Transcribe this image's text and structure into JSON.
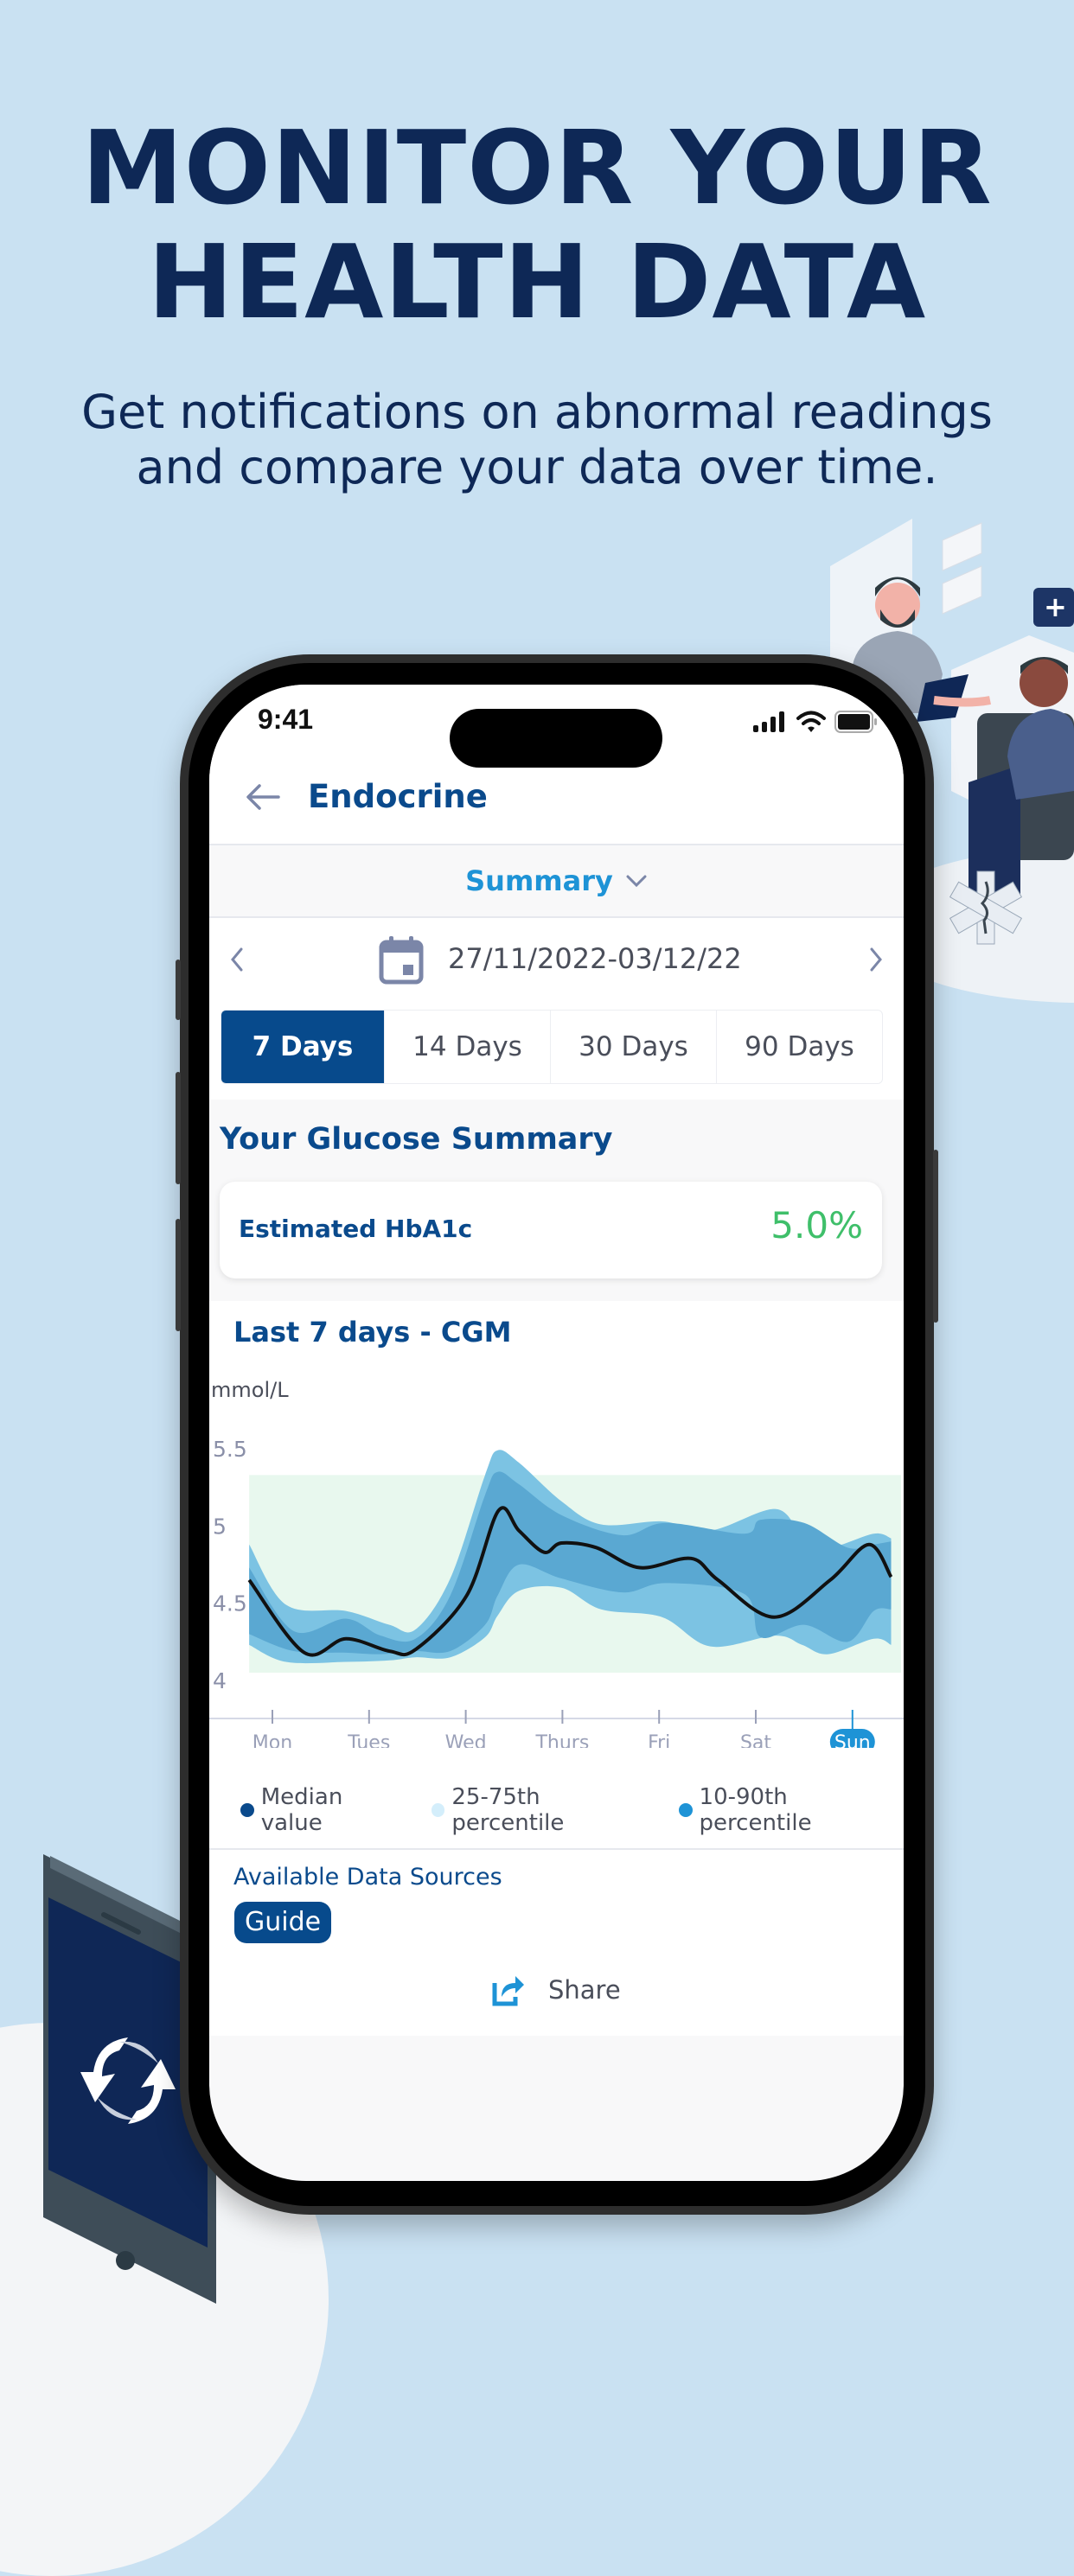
{
  "promo": {
    "headline_line1": "MONITOR YOUR",
    "headline_line2": "HEALTH DATA",
    "subtitle_line1": "Get notifications on abnormal readings",
    "subtitle_line2": "and compare your data over time."
  },
  "status_bar": {
    "time": "9:41",
    "icons": [
      "signal-icon",
      "wifi-icon",
      "battery-icon"
    ]
  },
  "header": {
    "back_icon": "arrow-left-icon",
    "title": "Endocrine"
  },
  "view_selector": {
    "label": "Summary",
    "icon": "chevron-down-icon"
  },
  "date_range": {
    "prev_icon": "chevron-left-icon",
    "calendar_icon": "calendar-icon",
    "text": "27/11/2022-03/12/22",
    "next_icon": "chevron-right-icon"
  },
  "range_tabs": [
    {
      "label": "7 Days",
      "active": true
    },
    {
      "label": "14 Days",
      "active": false
    },
    {
      "label": "30 Days",
      "active": false
    },
    {
      "label": "90 Days",
      "active": false
    }
  ],
  "glucose_summary": {
    "title": "Your Glucose Summary",
    "hba1c_label": "Estimated HbA1c",
    "hba1c_value": "5.0%"
  },
  "cgm": {
    "title": "Last 7 days - CGM"
  },
  "colors": {
    "brand_navy": "#074a8c",
    "accent_blue": "#1e93d6",
    "good_green": "#3fbf6a",
    "band_outer": "#7cc3e3",
    "band_inner": "#5aa8d2",
    "target_range": "#e8f8ee",
    "median_line": "#111111",
    "background": "#c9e1f2"
  },
  "chart_data": {
    "type": "area",
    "title": "Last 7 days - CGM",
    "ylabel": "mmol/L",
    "xlabel": "",
    "categories": [
      "Mon",
      "Tues",
      "Wed",
      "Thurs",
      "Fri",
      "Sat",
      "Sun"
    ],
    "highlighted_category": "Sun",
    "yticks": [
      "5.5",
      "5",
      "4.5",
      "4"
    ],
    "ylim": [
      4,
      5.5
    ],
    "xlim": [
      -0.24,
      6.4
    ],
    "target_range": [
      4.05,
      5.33
    ],
    "grid": false,
    "legend": [
      "Median value",
      "25-75th percentile",
      "10-90th percentile"
    ],
    "legend_position": "bottom",
    "series": [
      {
        "name": "10-90th percentile",
        "x": [
          -0.24,
          0.14,
          0.76,
          1.21,
          1.48,
          1.84,
          2.2,
          2.33,
          2.55,
          2.99,
          3.4,
          4.03,
          4.53,
          5.2,
          5.48,
          5.75,
          6.22,
          6.4
        ],
        "upper": [
          4.88,
          4.49,
          4.45,
          4.36,
          4.33,
          4.66,
          5.33,
          5.49,
          5.41,
          5.16,
          5.01,
          5.03,
          4.97,
          5.11,
          4.94,
          4.86,
          4.95,
          4.92
        ],
        "lower": [
          4.23,
          4.12,
          4.12,
          4.13,
          4.15,
          4.15,
          4.28,
          4.42,
          4.58,
          4.6,
          4.46,
          4.41,
          4.22,
          4.29,
          4.23,
          4.17,
          4.27,
          4.23
        ]
      },
      {
        "name": "25-75th percentile",
        "x": [
          -0.24,
          0.22,
          0.76,
          1.12,
          1.48,
          1.84,
          2.2,
          2.33,
          2.55,
          2.99,
          3.62,
          4.07,
          4.88,
          5.05,
          5.5,
          5.95,
          6.22,
          6.4
        ],
        "upper": [
          4.73,
          4.32,
          4.4,
          4.29,
          4.27,
          4.55,
          5.2,
          5.35,
          5.27,
          5.07,
          4.94,
          5.02,
          4.95,
          5.04,
          5.02,
          4.86,
          4.88,
          4.9
        ],
        "lower": [
          4.3,
          4.19,
          4.18,
          4.17,
          4.19,
          4.19,
          4.36,
          4.55,
          4.75,
          4.66,
          4.57,
          4.63,
          4.56,
          4.28,
          4.36,
          4.25,
          4.45,
          4.46
        ]
      },
      {
        "name": "Median value",
        "x": [
          -0.24,
          0.33,
          0.76,
          1.21,
          1.48,
          2.01,
          2.34,
          2.55,
          2.81,
          2.99,
          3.35,
          3.8,
          4.33,
          4.61,
          5.19,
          5.77,
          6.17,
          6.4
        ],
        "values": [
          4.65,
          4.18,
          4.27,
          4.19,
          4.2,
          4.55,
          5.1,
          4.97,
          4.83,
          4.89,
          4.86,
          4.73,
          4.79,
          4.65,
          4.41,
          4.65,
          4.88,
          4.67
        ]
      }
    ]
  },
  "footer": {
    "sources_label": "Available Data Sources",
    "guide_label": "Guide",
    "share_icon": "share-icon",
    "share_label": "Share"
  }
}
